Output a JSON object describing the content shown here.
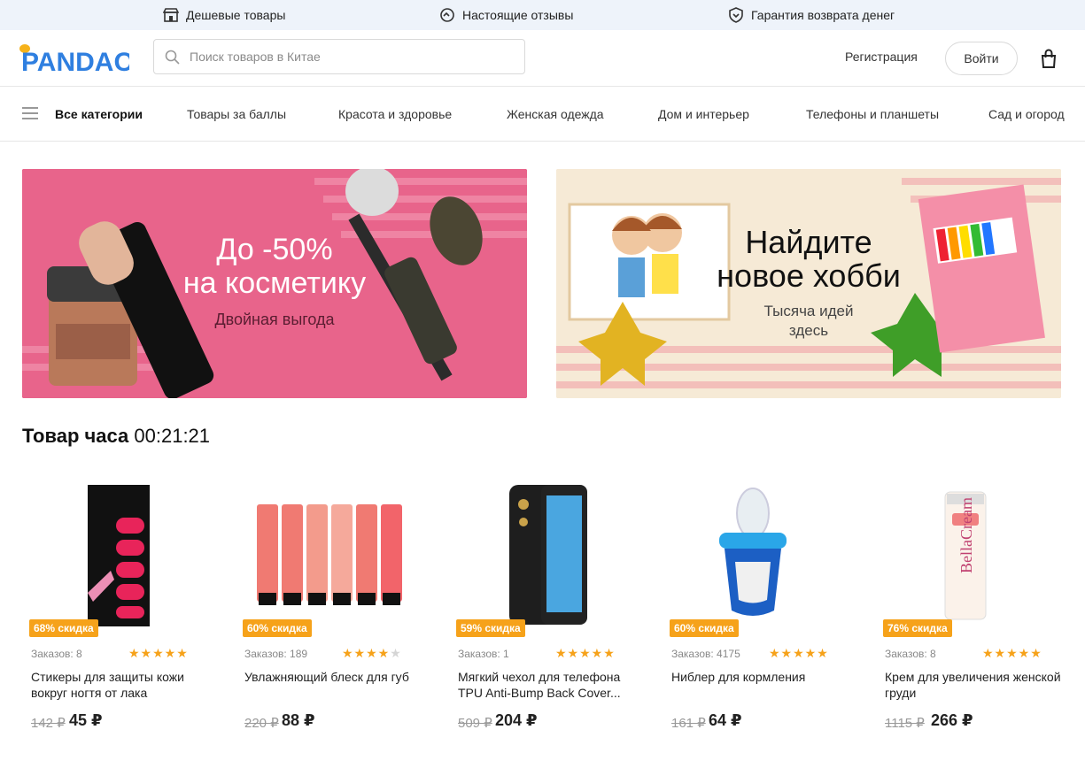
{
  "topbar": {
    "items": [
      {
        "label": "Дешевые товары",
        "icon": "shop-icon"
      },
      {
        "label": "Настоящие отзывы",
        "icon": "review-icon"
      },
      {
        "label": "Гарантия возврата денег",
        "icon": "shield-icon"
      }
    ]
  },
  "header": {
    "logo_text": "PANDAO",
    "search_placeholder": "Поиск товаров в Китае",
    "register_label": "Регистрация",
    "login_label": "Войти"
  },
  "nav": {
    "items": [
      "Все категории",
      "Товары за баллы",
      "Красота и здоровье",
      "Женская одежда",
      "Дом и интерьер",
      "Телефоны и планшеты",
      "Сад и огород"
    ]
  },
  "banners": [
    {
      "title_line1": "До -50%",
      "title_line2": "на косметику",
      "subtitle": "Двойная выгода"
    },
    {
      "title_line1": "Найдите",
      "title_line2": "новое хобби",
      "subtitle_line1": "Тысяча идей",
      "subtitle_line2": "здесь"
    }
  ],
  "hour_deal": {
    "title": "Товар часа",
    "timer": "00:21:21"
  },
  "products": [
    {
      "badge": "68% скидка",
      "orders": "Заказов: 8",
      "rating": 5,
      "name": "Стикеры для защиты кожи вокруг ногтя от лака",
      "old_price": "142 ₽",
      "price": "45 ₽"
    },
    {
      "badge": "60% скидка",
      "orders": "Заказов: 189",
      "rating": 4.5,
      "name": "Увлажняющий блеск для губ",
      "old_price": "220 ₽",
      "price": "88 ₽"
    },
    {
      "badge": "59% скидка",
      "orders": "Заказов: 1",
      "rating": 5,
      "name": "Мягкий чехол для телефона TPU Anti-Bump Back Cover...",
      "old_price": "509 ₽",
      "price": "204 ₽"
    },
    {
      "badge": "60% скидка",
      "orders": "Заказов: 4175",
      "rating": 5,
      "name": "Ниблер для кормления",
      "old_price": "161 ₽",
      "price": "64 ₽"
    },
    {
      "badge": "76% скидка",
      "orders": "Заказов: 8",
      "rating": 5,
      "name": "Крем для увеличения женской груди",
      "old_price": "1115 ₽",
      "price": "266 ₽"
    }
  ],
  "colors": {
    "accent_orange": "#f6a21a",
    "logo_blue": "#2f7fe0",
    "topbar_bg": "#eef3fa"
  }
}
